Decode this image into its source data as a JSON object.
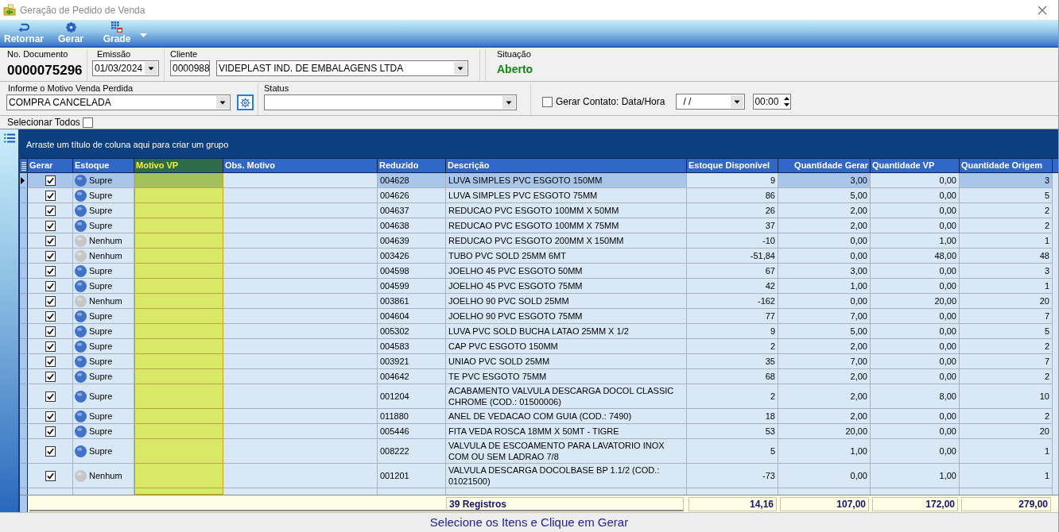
{
  "window": {
    "title": "Geração de Pedido de Venda"
  },
  "toolbar": [
    {
      "label": "Retornar",
      "kind": "back"
    },
    {
      "label": "Gerar",
      "kind": "generate"
    },
    {
      "label": "Grade",
      "kind": "grid"
    }
  ],
  "header": {
    "document": {
      "label": "No. Documento",
      "value": "0000075296"
    },
    "emissao": {
      "label": "Emissão",
      "value": "01/03/2024"
    },
    "cliente": {
      "label": "Cliente",
      "code": "0000988",
      "name": "VIDEPLAST IND. DE EMBALAGENS LTDA"
    },
    "situacao": {
      "label": "Situação",
      "value": "Aberto"
    }
  },
  "motivo": {
    "label": "Informe o Motivo Venda Perdida",
    "value": "COMPRA CANCELADA"
  },
  "status": {
    "label": "Status"
  },
  "contato": {
    "label": "Gerar Contato: Data/Hora",
    "checked": false,
    "date": "/ /",
    "time": "00:00"
  },
  "select_all": {
    "label": "Selecionar Todos",
    "checked": false
  },
  "grid": {
    "group_hint": "Arraste um título de coluna aqui para criar um grupo",
    "columns": [
      {
        "label": "Gerar",
        "selected": false
      },
      {
        "label": "Estoque",
        "selected": false
      },
      {
        "label": "Motivo VP",
        "selected": true
      },
      {
        "label": "Obs. Motivo",
        "selected": false
      },
      {
        "label": "Reduzido",
        "selected": false
      },
      {
        "label": "Descrição",
        "selected": false
      },
      {
        "label": "Estoque Disponível",
        "selected": false
      },
      {
        "label": "Quantidade Gerar",
        "selected": false
      },
      {
        "label": "Quantidade VP",
        "selected": false
      },
      {
        "label": "Quantidade Origem",
        "selected": false
      }
    ],
    "rows": [
      {
        "selected": true,
        "gerar": true,
        "estoque": "Supre",
        "color": "#3f72c8",
        "reduzido": "004628",
        "descricao": "LUVA SIMPLES PVC ESGOTO 150MM",
        "estoque_disponivel": "9",
        "quantidade_gerar": "3,00",
        "quantidade_vp": "0,00",
        "quantidade_origem": "3"
      },
      {
        "selected": false,
        "gerar": true,
        "estoque": "Supre",
        "color": "#3f72c8",
        "reduzido": "004626",
        "descricao": "LUVA SIMPLES PVC ESGOTO 75MM",
        "estoque_disponivel": "86",
        "quantidade_gerar": "5,00",
        "quantidade_vp": "0,00",
        "quantidade_origem": "5"
      },
      {
        "selected": false,
        "gerar": true,
        "estoque": "Supre",
        "color": "#3f72c8",
        "reduzido": "004637",
        "descricao": "REDUCAO PVC ESGOTO 100MM X 50MM",
        "estoque_disponivel": "26",
        "quantidade_gerar": "2,00",
        "quantidade_vp": "0,00",
        "quantidade_origem": "2"
      },
      {
        "selected": false,
        "gerar": true,
        "estoque": "Supre",
        "color": "#3f72c8",
        "reduzido": "004638",
        "descricao": "REDUCAO PVC ESGOTO 100MM X 75MM",
        "estoque_disponivel": "37",
        "quantidade_gerar": "2,00",
        "quantidade_vp": "0,00",
        "quantidade_origem": "2"
      },
      {
        "selected": false,
        "gerar": true,
        "estoque": "Nenhum",
        "color": "#c6c6c6",
        "reduzido": "004639",
        "descricao": "REDUCAO PVC ESGOTO 200MM X 150MM",
        "estoque_disponivel": "-10",
        "quantidade_gerar": "0,00",
        "quantidade_vp": "1,00",
        "quantidade_origem": "1"
      },
      {
        "selected": false,
        "gerar": true,
        "estoque": "Nenhum",
        "color": "#c6c6c6",
        "reduzido": "003426",
        "descricao": "TUBO PVC SOLD 25MM 6MT",
        "estoque_disponivel": "-51,84",
        "quantidade_gerar": "0,00",
        "quantidade_vp": "48,00",
        "quantidade_origem": "48"
      },
      {
        "selected": false,
        "gerar": true,
        "estoque": "Supre",
        "color": "#3f72c8",
        "reduzido": "004598",
        "descricao": "JOELHO 45 PVC ESGOTO 50MM",
        "estoque_disponivel": "67",
        "quantidade_gerar": "3,00",
        "quantidade_vp": "0,00",
        "quantidade_origem": "3"
      },
      {
        "selected": false,
        "gerar": true,
        "estoque": "Supre",
        "color": "#3f72c8",
        "reduzido": "004599",
        "descricao": "JOELHO 45 PVC ESGOTO 75MM",
        "estoque_disponivel": "42",
        "quantidade_gerar": "1,00",
        "quantidade_vp": "0,00",
        "quantidade_origem": "1"
      },
      {
        "selected": false,
        "gerar": true,
        "estoque": "Nenhum",
        "color": "#c6c6c6",
        "reduzido": "003861",
        "descricao": "JOELHO 90 PVC SOLD 25MM",
        "estoque_disponivel": "-162",
        "quantidade_gerar": "0,00",
        "quantidade_vp": "20,00",
        "quantidade_origem": "20"
      },
      {
        "selected": false,
        "gerar": true,
        "estoque": "Supre",
        "color": "#3f72c8",
        "reduzido": "004604",
        "descricao": "JOELHO 90 PVC ESGOTO 75MM",
        "estoque_disponivel": "77",
        "quantidade_gerar": "7,00",
        "quantidade_vp": "0,00",
        "quantidade_origem": "7"
      },
      {
        "selected": false,
        "gerar": true,
        "estoque": "Supre",
        "color": "#3f72c8",
        "reduzido": "005302",
        "descricao": "LUVA PVC SOLD BUCHA LATAO 25MM X 1/2",
        "estoque_disponivel": "9",
        "quantidade_gerar": "5,00",
        "quantidade_vp": "0,00",
        "quantidade_origem": "5"
      },
      {
        "selected": false,
        "gerar": true,
        "estoque": "Supre",
        "color": "#3f72c8",
        "reduzido": "004583",
        "descricao": "CAP PVC ESGOTO 150MM",
        "estoque_disponivel": "2",
        "quantidade_gerar": "2,00",
        "quantidade_vp": "0,00",
        "quantidade_origem": "2"
      },
      {
        "selected": false,
        "gerar": true,
        "estoque": "Supre",
        "color": "#3f72c8",
        "reduzido": "003921",
        "descricao": "UNIAO PVC SOLD 25MM",
        "estoque_disponivel": "35",
        "quantidade_gerar": "7,00",
        "quantidade_vp": "0,00",
        "quantidade_origem": "7"
      },
      {
        "selected": false,
        "gerar": true,
        "estoque": "Supre",
        "color": "#3f72c8",
        "reduzido": "004642",
        "descricao": "TE PVC ESGOTO 75MM",
        "estoque_disponivel": "68",
        "quantidade_gerar": "2,00",
        "quantidade_vp": "0,00",
        "quantidade_origem": "2"
      },
      {
        "selected": false,
        "gerar": true,
        "estoque": "Supre",
        "color": "#3f72c8",
        "reduzido": "001204",
        "descricao": "ACABAMENTO VALVULA DESCARGA DOCOL CLASSIC CHROME (COD.: 01500006)",
        "estoque_disponivel": "2",
        "quantidade_gerar": "2,00",
        "quantidade_vp": "8,00",
        "quantidade_origem": "10"
      },
      {
        "selected": false,
        "gerar": true,
        "estoque": "Supre",
        "color": "#3f72c8",
        "reduzido": "011880",
        "descricao": "ANEL DE VEDACAO COM GUIA (COD.: 7490)",
        "estoque_disponivel": "18",
        "quantidade_gerar": "2,00",
        "quantidade_vp": "0,00",
        "quantidade_origem": "2"
      },
      {
        "selected": false,
        "gerar": true,
        "estoque": "Supre",
        "color": "#3f72c8",
        "reduzido": "005446",
        "descricao": "FITA VEDA ROSCA 18MM X 50MT - TIGRE",
        "estoque_disponivel": "53",
        "quantidade_gerar": "20,00",
        "quantidade_vp": "0,00",
        "quantidade_origem": "20"
      },
      {
        "selected": false,
        "gerar": true,
        "estoque": "Supre",
        "color": "#3f72c8",
        "reduzido": "008222",
        "descricao": "VALVULA DE ESCOAMENTO PARA LAVATORIO INOX COM OU SEM LADRAO 7/8",
        "estoque_disponivel": "5",
        "quantidade_gerar": "1,00",
        "quantidade_vp": "0,00",
        "quantidade_origem": "1"
      },
      {
        "selected": false,
        "gerar": true,
        "estoque": "Nenhum",
        "color": "#c6c6c6",
        "reduzido": "001201",
        "descricao": "VALVULA DESCARGA DOCOLBASE BP 1.1/2 (COD.: 01021500)",
        "estoque_disponivel": "-73",
        "quantidade_gerar": "0,00",
        "quantidade_vp": "1,00",
        "quantidade_origem": "1"
      }
    ],
    "footer": {
      "count": "39 Registros",
      "totals": [
        "14,16",
        "107,00",
        "172,00",
        "279,00"
      ]
    }
  },
  "status_bar": "Selecione os Itens e Clique em Gerar"
}
